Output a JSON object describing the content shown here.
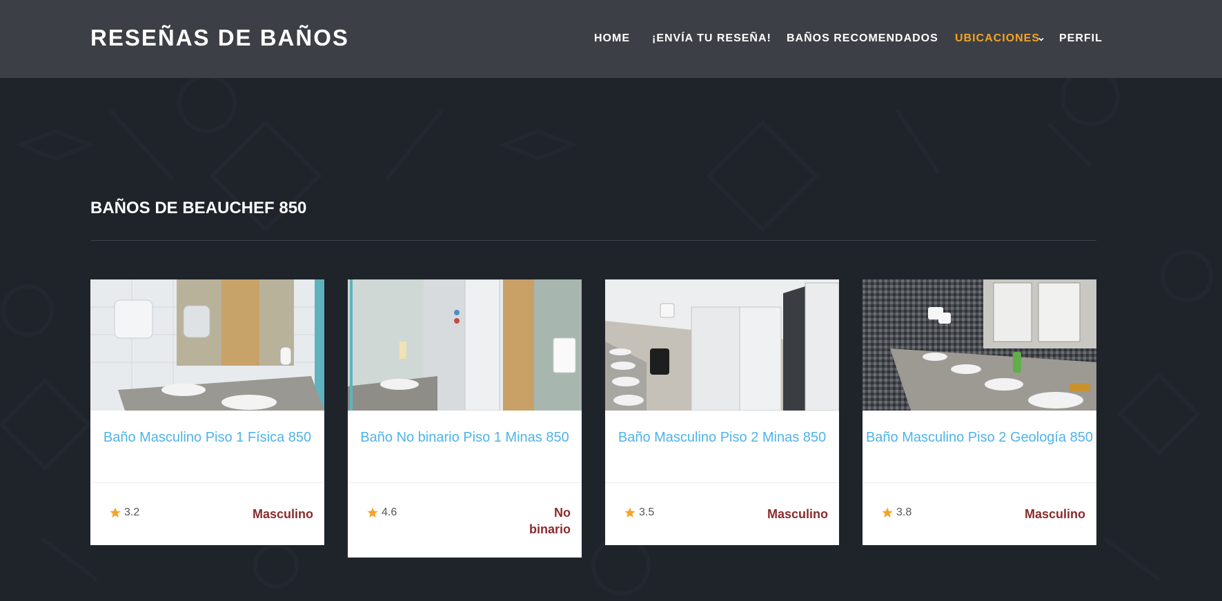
{
  "brand": {
    "logo": "RESEÑAS DE BAÑOS"
  },
  "nav": {
    "items": [
      {
        "label": "HOME"
      },
      {
        "label": "¡ENVÍA TU RESEÑA!"
      },
      {
        "label": "BAÑOS RECOMENDADOS"
      },
      {
        "label": "UBICACIONES"
      },
      {
        "label": "PERFIL"
      }
    ],
    "active_color": "#f5a425"
  },
  "section": {
    "title": "BAÑOS DE BEAUCHEF 850"
  },
  "cards": [
    {
      "title": "Baño Masculino Piso 1 Física 850",
      "rating": "3.2",
      "tag": "Masculino"
    },
    {
      "title": "Baño No binario Piso 1 Minas 850",
      "rating": "4.6",
      "tag": "No binario"
    },
    {
      "title": "Baño Masculino Piso 2 Minas 850",
      "rating": "3.5",
      "tag": "Masculino"
    },
    {
      "title": "Baño Masculino Piso 2 Geología 850",
      "rating": "3.8",
      "tag": "Masculino"
    }
  ],
  "colors": {
    "title_blue": "#4fb3e8",
    "tag_red": "#8a2b2b",
    "star": "#f5a425",
    "background": "#1f232a",
    "header": "#3c4046"
  }
}
